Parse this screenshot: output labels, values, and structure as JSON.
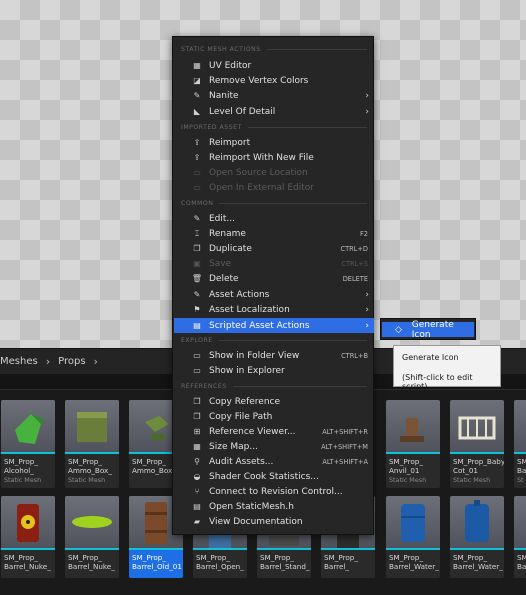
{
  "breadcrumb": {
    "items": [
      "Meshes",
      "Props"
    ]
  },
  "menu": {
    "sections": {
      "static_mesh": "STATIC MESH ACTIONS",
      "imported": "IMPORTED ASSET",
      "common": "COMMON",
      "explore": "EXPLORE",
      "references": "REFERENCES"
    },
    "items": [
      {
        "label": "UV Editor",
        "icon": "uv-editor-icon"
      },
      {
        "label": "Remove Vertex Colors",
        "icon": "vertex-colors-icon"
      },
      {
        "label": "Nanite",
        "icon": "wrench-icon",
        "submenu": true
      },
      {
        "label": "Level Of Detail",
        "icon": "lod-icon",
        "submenu": true
      },
      {
        "label": "Reimport",
        "icon": "reimport-icon"
      },
      {
        "label": "Reimport With New File",
        "icon": "reimport-file-icon"
      },
      {
        "label": "Open Source Location",
        "icon": "folder-icon",
        "disabled": true
      },
      {
        "label": "Open In External Editor",
        "icon": "external-editor-icon",
        "disabled": true
      },
      {
        "label": "Edit...",
        "icon": "pencil-icon"
      },
      {
        "label": "Rename",
        "icon": "rename-icon",
        "shortcut": "F2"
      },
      {
        "label": "Duplicate",
        "icon": "duplicate-icon",
        "shortcut": "CTRL+D"
      },
      {
        "label": "Save",
        "icon": "save-icon",
        "shortcut": "CTRL+S",
        "disabled": true
      },
      {
        "label": "Delete",
        "icon": "trash-icon",
        "shortcut": "DELETE"
      },
      {
        "label": "Asset Actions",
        "icon": "wrench-icon",
        "submenu": true
      },
      {
        "label": "Asset Localization",
        "icon": "flag-icon",
        "submenu": true
      },
      {
        "label": "Scripted Asset Actions",
        "icon": "script-icon",
        "submenu": true,
        "active": true
      },
      {
        "label": "Show in Folder View",
        "icon": "folder-view-icon",
        "shortcut": "CTRL+B"
      },
      {
        "label": "Show in Explorer",
        "icon": "explorer-icon"
      },
      {
        "label": "Copy Reference",
        "icon": "copy-icon"
      },
      {
        "label": "Copy File Path",
        "icon": "copy-path-icon"
      },
      {
        "label": "Reference Viewer...",
        "icon": "reference-viewer-icon",
        "shortcut": "ALT+SHIFT+R"
      },
      {
        "label": "Size Map...",
        "icon": "size-map-icon",
        "shortcut": "ALT+SHIFT+M"
      },
      {
        "label": "Audit Assets...",
        "icon": "audit-icon",
        "shortcut": "ALT+SHIFT+A"
      },
      {
        "label": "Shader Cook Statistics...",
        "icon": "statistics-icon"
      },
      {
        "label": "Connect to Revision Control...",
        "icon": "revision-control-icon"
      },
      {
        "label": "Open StaticMesh.h",
        "icon": "source-file-icon"
      },
      {
        "label": "View Documentation",
        "icon": "documentation-icon"
      }
    ]
  },
  "submenu": {
    "label": "Generate Icon",
    "icon": "script-action-icon"
  },
  "tooltip": {
    "line1": "Generate Icon",
    "line2": "(Shift-click to edit script)"
  },
  "assets": {
    "row1": [
      {
        "name": "SM_Prop_\nAlcohol_",
        "type": "Static Mesh"
      },
      {
        "name": "SM_Prop_\nAmmo_Box_",
        "type": "Static Mesh"
      },
      {
        "name": "SM_Prop_\nAmmo_Box_",
        "type": ""
      },
      {
        "name": "SM_Prop_\nAnvil_01",
        "type": "Static Mesh"
      },
      {
        "name": "SM_Prop_Baby\nCot_01",
        "type": "Static Mesh"
      },
      {
        "name": "SM_\nBa",
        "type": "St"
      }
    ],
    "row2": [
      {
        "name": "SM_Prop_\nBarrel_Nuke_",
        "type": ""
      },
      {
        "name": "SM_Prop_\nBarrel_Nuke_",
        "type": ""
      },
      {
        "name": "SM_Prop_\nBarrel_Old_01",
        "type": "",
        "selected": true
      },
      {
        "name": "SM_Prop_\nBarrel_Open_",
        "type": ""
      },
      {
        "name": "SM_Prop_\nBarrel_Stand_",
        "type": ""
      },
      {
        "name": "SM_Prop_\nBarrel_",
        "type": ""
      },
      {
        "name": "SM_Prop_\nBarrel_Water_",
        "type": ""
      },
      {
        "name": "SM_Prop_\nBarrel_Water_",
        "type": ""
      },
      {
        "name": "SM_\nBa",
        "type": ""
      }
    ]
  },
  "colors": {
    "accent": "#2f6de5",
    "asset_stripe": "#0ec0d8"
  }
}
